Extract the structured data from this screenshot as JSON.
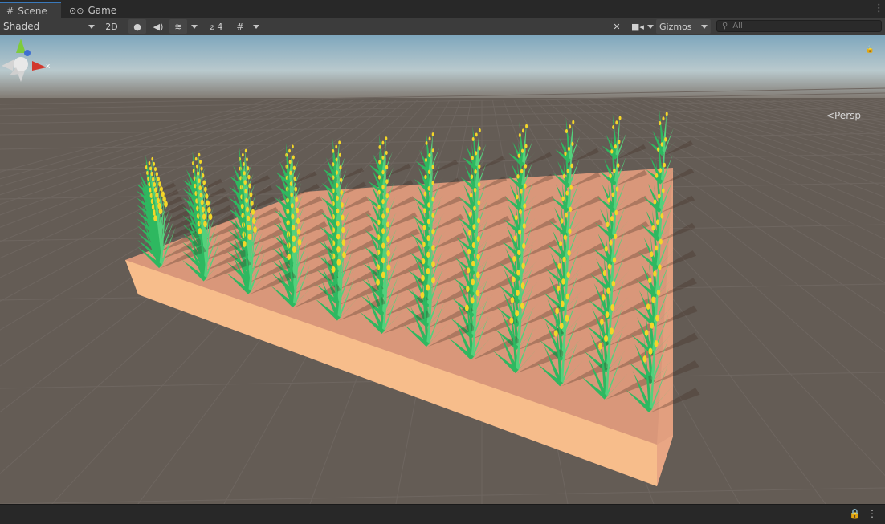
{
  "tabs": [
    {
      "label": "Scene",
      "icon": "hash-grid-icon",
      "active": true
    },
    {
      "label": "Game",
      "icon": "gamepad-icon",
      "active": false
    }
  ],
  "toolbar": {
    "draw_mode": "Shaded",
    "mode_2d": "2D",
    "hidden_count": "4",
    "gizmos": "Gizmos",
    "search_placeholder": "All"
  },
  "scene": {
    "projection_label": "Persp",
    "gizmo_axis_label": "x",
    "colors": {
      "ground": "#645c55",
      "sky_top": "#7fa7bd",
      "soil_top": "#d9977a",
      "soil_side": "#f7bd8b",
      "soil_right": "#e29f7f",
      "leaf": "#2eb860",
      "leaf_light": "#53d17c",
      "grain": "#f4d629"
    }
  }
}
